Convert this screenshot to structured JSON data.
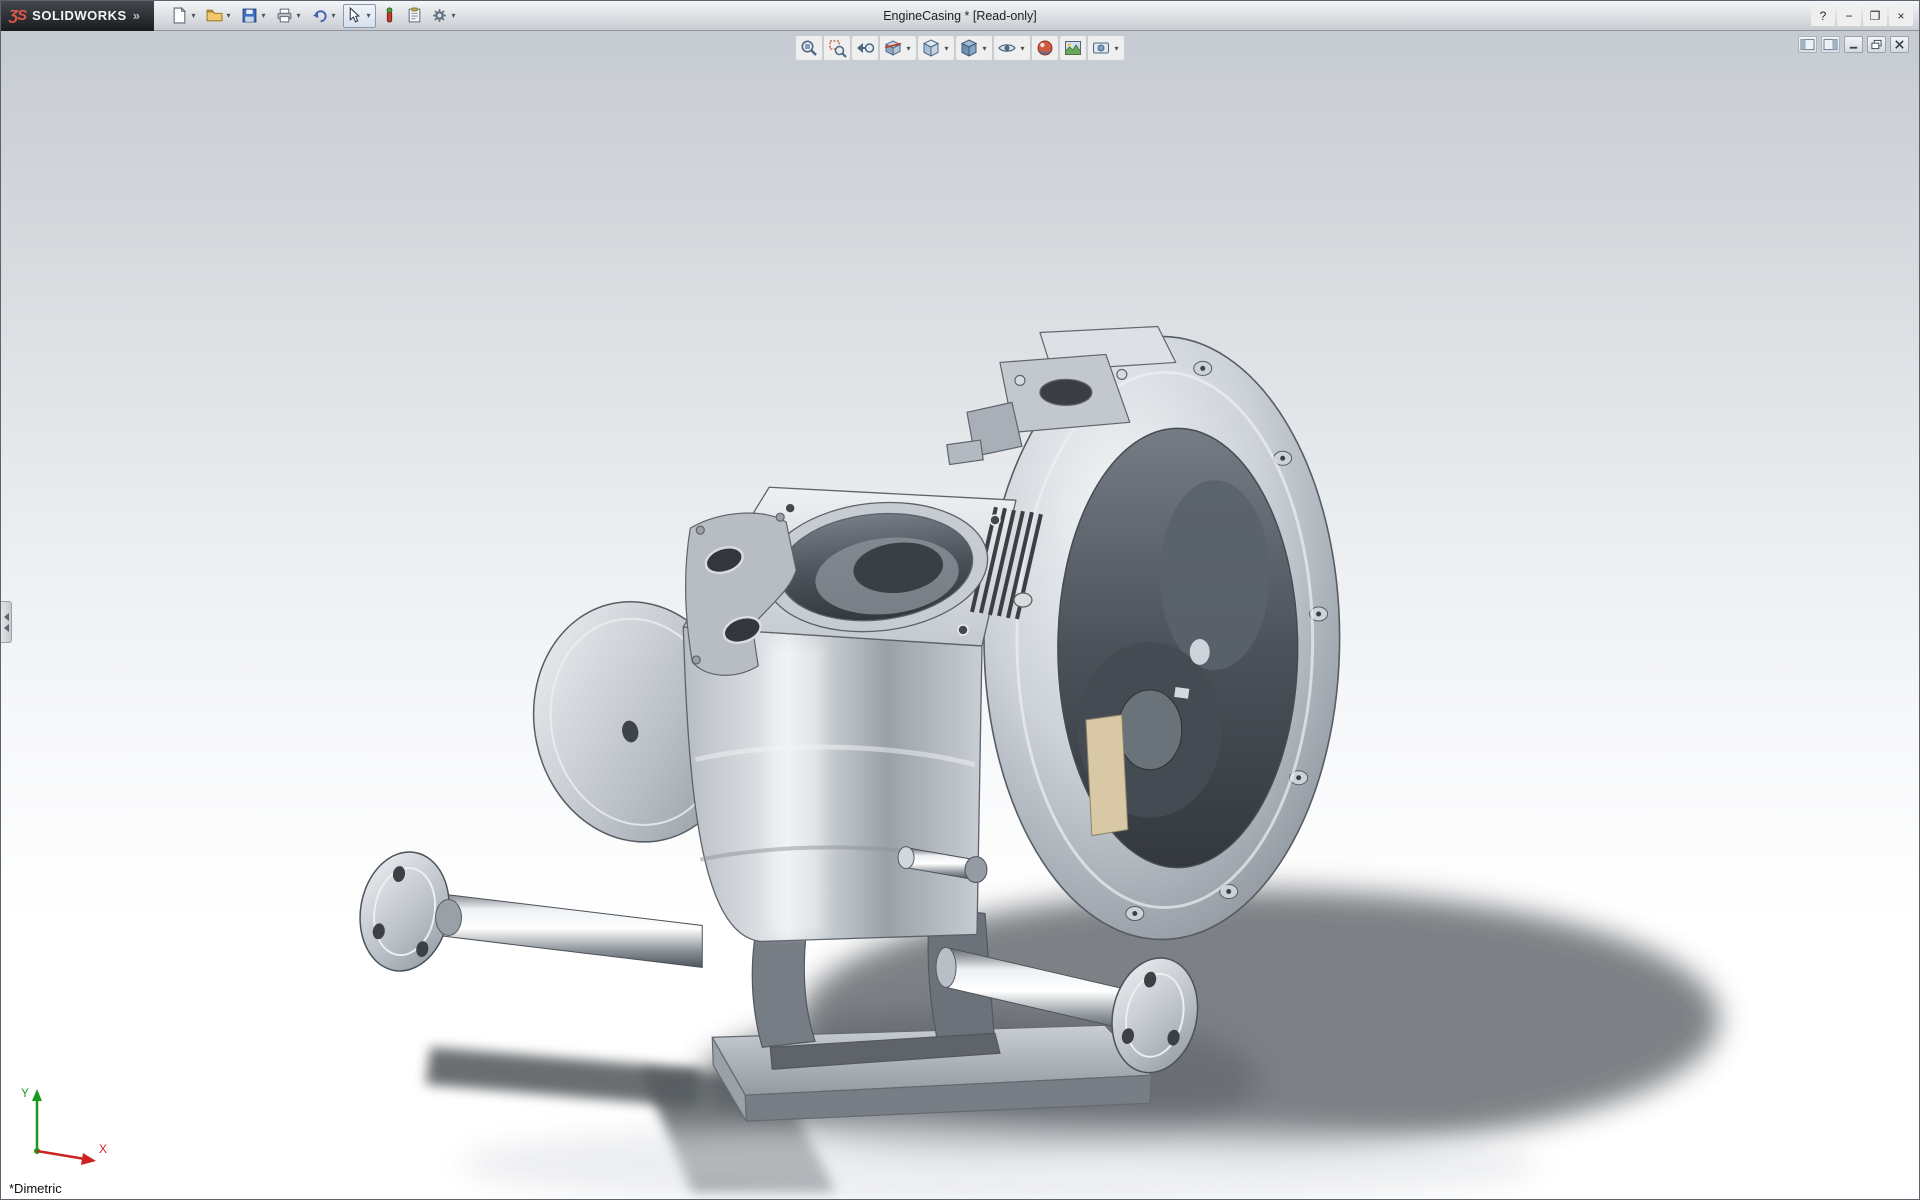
{
  "window": {
    "logo_mark": "ƷS",
    "brand": "SOLIDWORKS",
    "logo_chevron": "»",
    "title": "EngineCasing * [Read-only]",
    "controls": {
      "help": "?",
      "minimize": "−",
      "restore": "❐",
      "close": "×"
    }
  },
  "ui": {
    "dropdown_glyph": "▾"
  },
  "main_toolbar": {
    "items": [
      {
        "name": "new-document",
        "dropdown": true
      },
      {
        "name": "open",
        "dropdown": true
      },
      {
        "name": "save",
        "dropdown": true
      },
      {
        "name": "print",
        "dropdown": true
      },
      {
        "name": "undo",
        "dropdown": true
      },
      {
        "name": "select",
        "dropdown": true,
        "active": true
      },
      {
        "name": "selection-filter",
        "dropdown": false
      },
      {
        "name": "properties",
        "dropdown": false
      },
      {
        "name": "options",
        "dropdown": true
      }
    ]
  },
  "heads_up_toolbar": {
    "items": [
      {
        "name": "zoom-to-fit"
      },
      {
        "name": "zoom-to-area"
      },
      {
        "name": "previous-view"
      },
      {
        "name": "section-view",
        "dropdown": true
      },
      {
        "name": "view-orientation",
        "dropdown": true
      },
      {
        "name": "display-style",
        "dropdown": true
      },
      {
        "name": "hide-show-items",
        "dropdown": true
      },
      {
        "name": "edit-appearance"
      },
      {
        "name": "apply-scene"
      },
      {
        "name": "view-settings",
        "dropdown": true
      }
    ]
  },
  "document_window": {
    "pane_toggles": [
      "show-display-pane",
      "show-task-pane"
    ],
    "controls": [
      "minimize",
      "restore",
      "close"
    ]
  },
  "viewport": {
    "orientation_label": "*Dimetric",
    "triad": {
      "x_label": "X",
      "y_label": "Y"
    },
    "model_subject": "engine-casing-3d-model",
    "colors": {
      "background_top": "#c6cbd2",
      "background_bottom": "#ffffff",
      "metal_light": "#f4f6f8",
      "metal_dark": "#6d737a",
      "shadow": "#5d6267",
      "accent_part": "#d9c8a5",
      "logo_accent": "#e0584a"
    }
  }
}
